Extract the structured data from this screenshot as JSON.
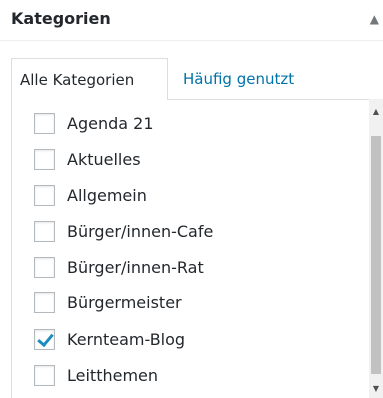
{
  "header": {
    "title": "Kategorien",
    "toggle_icon": "collapse-arrow-icon"
  },
  "tabs": [
    {
      "label": "Alle Kategorien",
      "active": true
    },
    {
      "label": "Häufig genutzt",
      "active": false
    }
  ],
  "categories": [
    {
      "label": "Agenda 21",
      "checked": false
    },
    {
      "label": "Aktuelles",
      "checked": false
    },
    {
      "label": "Allgemein",
      "checked": false
    },
    {
      "label": "Bürger/innen-Cafe",
      "checked": false
    },
    {
      "label": "Bürger/innen-Rat",
      "checked": false
    },
    {
      "label": "Bürgermeister",
      "checked": false
    },
    {
      "label": "Kernteam-Blog",
      "checked": true
    },
    {
      "label": "Leitthemen",
      "checked": false
    }
  ],
  "colors": {
    "link": "#0073aa",
    "check": "#1e8cbe",
    "border": "#dddddd"
  }
}
